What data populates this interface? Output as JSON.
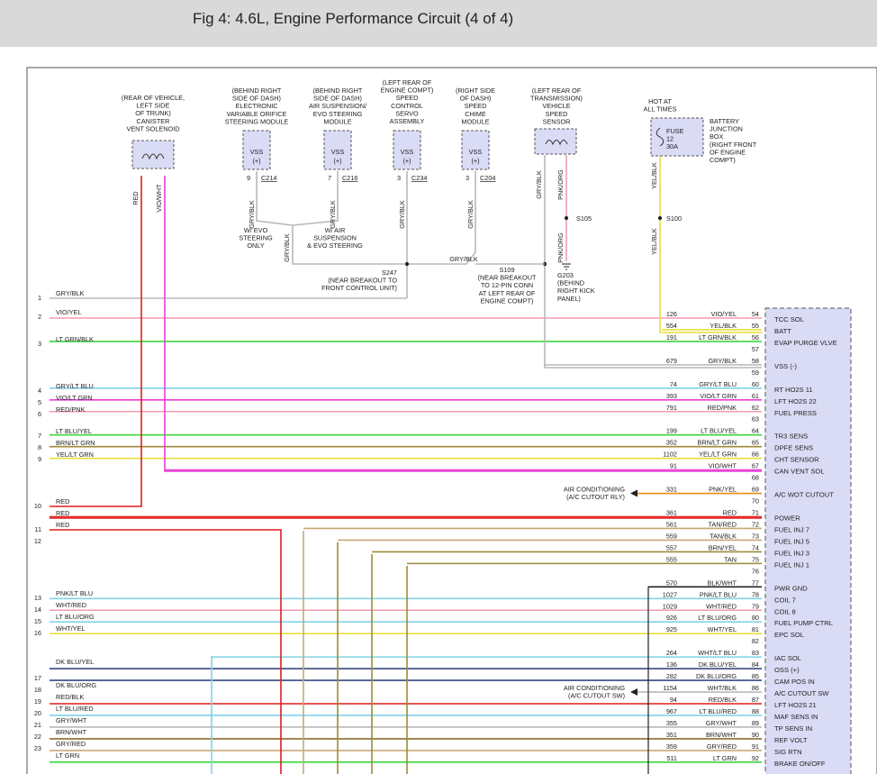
{
  "header": {
    "title": "Fig 4: 4.6L, Engine Performance Circuit (4 of 4)"
  },
  "colors": {
    "gray": "#b8b8b8",
    "violet": "#ea3ed8",
    "yellow": "#e6df3d",
    "red": "#e21c1c",
    "green": "#3bd63b",
    "lightblue": "#7fd3e8",
    "tan": "#c8a878",
    "brown": "#8b6f2e",
    "olive": "#9c8a3a",
    "orange": "#ef8a1e",
    "pink": "#f59cae",
    "darkblue": "#344a80",
    "black": "#222222",
    "module_fill": "#dadcf6"
  },
  "components": {
    "canister": {
      "lines": [
        "(REAR OF VEHICLE,",
        "LEFT SIDE",
        "OF TRUNK)",
        "CANISTER",
        "VENT SOLENOID"
      ]
    },
    "evo": {
      "lines": [
        "(BEHIND RIGHT",
        "SIDE OF DASH)",
        "ELECTRONIC",
        "VARIABLE ORIFICE",
        "STEERING MODULE"
      ],
      "box": [
        "VSS",
        "(+)"
      ],
      "pin": "9",
      "conn": "C214",
      "wire": "GRY/BLK"
    },
    "air": {
      "lines": [
        "(BEHIND RIGHT",
        "SIDE OF DASH)",
        "AIR SUSPENSION/",
        "EVO STEERING",
        "MODULE"
      ],
      "box": [
        "VSS",
        "(+)"
      ],
      "pin": "7",
      "conn": "C216",
      "wire": "GRY/BLK"
    },
    "servo": {
      "lines": [
        "(LEFT REAR OF",
        "ENGINE COMPT)",
        "SPEED",
        "CONTROL",
        "SERVO",
        "ASSEMBLY"
      ],
      "box": [
        "VSS",
        "(+)"
      ],
      "pin": "3",
      "conn": "C234",
      "wire": "GRY/BLK"
    },
    "chime": {
      "lines": [
        "(RIGHT SIDE",
        "OF DASH)",
        "SPEED",
        "CHIME",
        "MODULE"
      ],
      "box": [
        "VSS",
        "(+)"
      ],
      "pin": "3",
      "conn": "C204",
      "wire": "GRY/BLK"
    },
    "vss_sensor": {
      "lines": [
        "(LEFT REAR OF",
        "TRANSMISSION)",
        "VEHICLE",
        "SPEED",
        "SENSOR"
      ],
      "wire_left": "GRY/BLK",
      "wire_right": "PNK/ORG"
    },
    "hot": {
      "lines": [
        "HOT AT",
        "ALL TIMES"
      ]
    },
    "fuse": {
      "lines": [
        "FUSE",
        "12",
        "30A"
      ]
    },
    "bjb": {
      "lines": [
        "BATTERY",
        "JUNCTION",
        "BOX",
        "(RIGHT FRONT",
        "OF ENGINE",
        "COMPT)"
      ]
    }
  },
  "notes": {
    "evo_only": [
      "W/ EVO",
      "STEERING",
      "ONLY"
    ],
    "air_susp": [
      "W/ AIR",
      "SUSPENSION",
      "& EVO STEERING"
    ],
    "s247": [
      "S247",
      "(NEAR BREAKOUT TO",
      "FRONT CONTROL UNIT)"
    ],
    "s109": [
      "S109",
      "(NEAR BREAKOUT",
      "TO 12-PIN CONN",
      "AT LEFT REAR OF",
      "ENGINE COMPT)"
    ],
    "g203": [
      "G203",
      "(BEHIND",
      "RIGHT KICK",
      "PANEL)"
    ],
    "s105": "S105",
    "s100": "S100",
    "ac_rly": [
      "AIR CONDITIONING",
      "(A/C CUTOUT RLY)"
    ],
    "ac_sw": [
      "AIR CONDITIONING",
      "(A/C CUTOUT SW)"
    ],
    "vert_gry": "GRY/BLK",
    "vert_pnk": "PNK/ORG",
    "vert_red": "RED",
    "vert_vio": "VIO/WHT",
    "vert_yel_top": "YEL/BLK",
    "vert_yel_bot": "YEL/BLK",
    "horiz_gry": "GRY/BLK"
  },
  "left_rows": [
    {
      "num": "1",
      "label": "GRY/BLK"
    },
    {
      "num": "2",
      "label": "VIO/YEL"
    },
    {
      "num": "3",
      "label": "LT GRN/BLK"
    },
    {
      "num": "4",
      "label": "GRY/LT BLU"
    },
    {
      "num": "5",
      "label": "VIO/LT GRN"
    },
    {
      "num": "6",
      "label": "RED/PNK"
    },
    {
      "num": "7",
      "label": "LT BLU/YEL"
    },
    {
      "num": "8",
      "label": "BRN/LT GRN"
    },
    {
      "num": "9",
      "label": "YEL/LT GRN"
    },
    {
      "num": "10",
      "label": "RED"
    },
    {
      "num": "",
      "label": "RED"
    },
    {
      "num": "11",
      "label": "RED"
    },
    {
      "num": "12",
      "label": ""
    },
    {
      "num": "13",
      "label": "PNK/LT BLU"
    },
    {
      "num": "14",
      "label": "WHT/RED"
    },
    {
      "num": "15",
      "label": "LT BLU/ORG"
    },
    {
      "num": "16",
      "label": "WHT/YEL"
    },
    {
      "num": "",
      "label": "DK BLU/YEL"
    },
    {
      "num": "17",
      "label": ""
    },
    {
      "num": "18",
      "label": "DK BLU/ORG"
    },
    {
      "num": "19",
      "label": "RED/BLK"
    },
    {
      "num": "20",
      "label": "LT BLU/RED"
    },
    {
      "num": "21",
      "label": "GRY/WHT"
    },
    {
      "num": "22",
      "label": "BRN/WHT"
    },
    {
      "num": "23",
      "label": "GRY/RED"
    },
    {
      "num": "",
      "label": "LT GRN"
    }
  ],
  "pcm_pins": [
    {
      "circuit": "126",
      "wire": "VIO/YEL",
      "pin": "54",
      "fn": "TCC SOL"
    },
    {
      "circuit": "554",
      "wire": "YEL/BLK",
      "pin": "55",
      "fn": "BATT"
    },
    {
      "circuit": "191",
      "wire": "LT GRN/BLK",
      "pin": "56",
      "fn": "EVAP PURGE VLVE"
    },
    {
      "circuit": "",
      "wire": "",
      "pin": "57",
      "fn": ""
    },
    {
      "circuit": "679",
      "wire": "GRY/BLK",
      "pin": "58",
      "fn": "VSS (-)"
    },
    {
      "circuit": "",
      "wire": "",
      "pin": "59",
      "fn": ""
    },
    {
      "circuit": "74",
      "wire": "GRY/LT BLU",
      "pin": "60",
      "fn": "RT HO2S 11"
    },
    {
      "circuit": "393",
      "wire": "VIO/LT GRN",
      "pin": "61",
      "fn": "LFT HO2S 22"
    },
    {
      "circuit": "791",
      "wire": "RED/PNK",
      "pin": "62",
      "fn": "FUEL PRESS"
    },
    {
      "circuit": "",
      "wire": "",
      "pin": "63",
      "fn": ""
    },
    {
      "circuit": "199",
      "wire": "LT BLU/YEL",
      "pin": "64",
      "fn": "TR3 SENS"
    },
    {
      "circuit": "352",
      "wire": "BRN/LT GRN",
      "pin": "65",
      "fn": "DPFE SENS"
    },
    {
      "circuit": "1102",
      "wire": "YEL/LT GRN",
      "pin": "66",
      "fn": "CHT SENSOR"
    },
    {
      "circuit": "91",
      "wire": "VIO/WHT",
      "pin": "67",
      "fn": "CAN VENT SOL"
    },
    {
      "circuit": "",
      "wire": "",
      "pin": "68",
      "fn": ""
    },
    {
      "circuit": "331",
      "wire": "PNK/YEL",
      "pin": "69",
      "fn": "A/C WOT CUTOUT"
    },
    {
      "circuit": "",
      "wire": "",
      "pin": "70",
      "fn": ""
    },
    {
      "circuit": "361",
      "wire": "RED",
      "pin": "71",
      "fn": "POWER"
    },
    {
      "circuit": "561",
      "wire": "TAN/RED",
      "pin": "72",
      "fn": "FUEL INJ 7"
    },
    {
      "circuit": "559",
      "wire": "TAN/BLK",
      "pin": "73",
      "fn": "FUEL INJ 5"
    },
    {
      "circuit": "557",
      "wire": "BRN/YEL",
      "pin": "74",
      "fn": "FUEL INJ 3"
    },
    {
      "circuit": "555",
      "wire": "TAN",
      "pin": "75",
      "fn": "FUEL INJ 1"
    },
    {
      "circuit": "",
      "wire": "",
      "pin": "76",
      "fn": ""
    },
    {
      "circuit": "570",
      "wire": "BLK/WHT",
      "pin": "77",
      "fn": "PWR GND"
    },
    {
      "circuit": "1027",
      "wire": "PNK/LT BLU",
      "pin": "78",
      "fn": "COIL 7"
    },
    {
      "circuit": "1029",
      "wire": "WHT/RED",
      "pin": "79",
      "fn": "COIL 8"
    },
    {
      "circuit": "926",
      "wire": "LT BLU/ORG",
      "pin": "80",
      "fn": "FUEL PUMP CTRL"
    },
    {
      "circuit": "925",
      "wire": "WHT/YEL",
      "pin": "81",
      "fn": "EPC SOL"
    },
    {
      "circuit": "",
      "wire": "",
      "pin": "82",
      "fn": ""
    },
    {
      "circuit": "264",
      "wire": "WHT/LT BLU",
      "pin": "83",
      "fn": "IAC SOL"
    },
    {
      "circuit": "136",
      "wire": "DK BLU/YEL",
      "pin": "84",
      "fn": "OSS (+)"
    },
    {
      "circuit": "282",
      "wire": "DK BLU/ORG",
      "pin": "85",
      "fn": "CAM POS IN"
    },
    {
      "circuit": "1154",
      "wire": "WHT/BLK",
      "pin": "86",
      "fn": "A/C CUTOUT SW"
    },
    {
      "circuit": "94",
      "wire": "RED/BLK",
      "pin": "87",
      "fn": "LFT HO2S 21"
    },
    {
      "circuit": "967",
      "wire": "LT BLU/RED",
      "pin": "88",
      "fn": "MAF SENS IN"
    },
    {
      "circuit": "355",
      "wire": "GRY/WHT",
      "pin": "89",
      "fn": "TP SENS IN"
    },
    {
      "circuit": "351",
      "wire": "BRN/WHT",
      "pin": "90",
      "fn": "REF VOLT"
    },
    {
      "circuit": "359",
      "wire": "GRY/RED",
      "pin": "91",
      "fn": "SIG RTN"
    },
    {
      "circuit": "511",
      "wire": "LT GRN",
      "pin": "92",
      "fn": "BRAKE ON/OFF"
    }
  ]
}
